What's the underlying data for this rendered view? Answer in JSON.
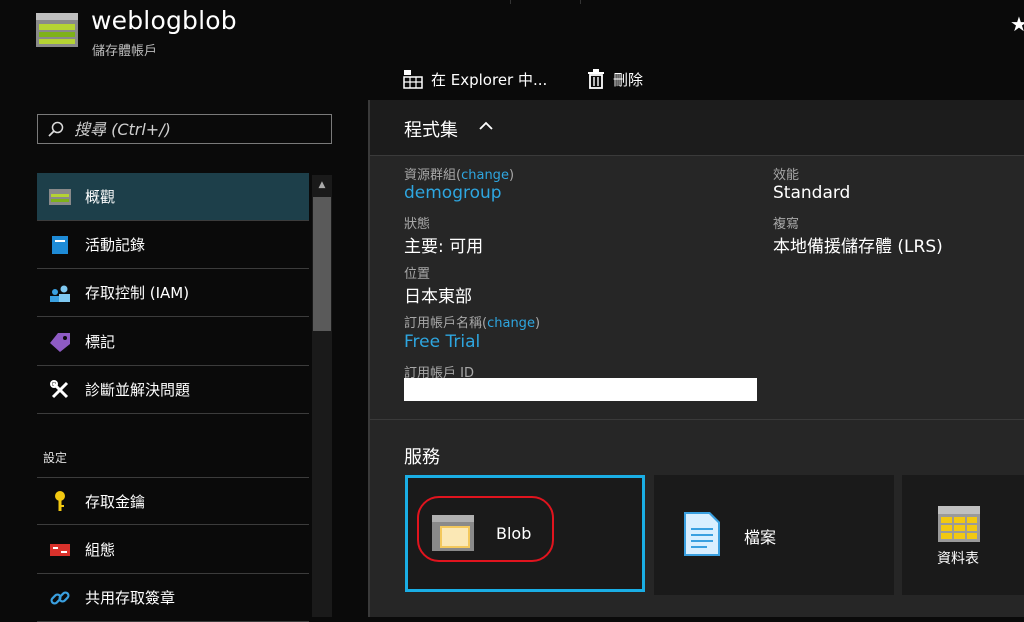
{
  "header": {
    "title": "weblogblob",
    "subtitle": "儲存體帳戶",
    "pin_glyph": "★"
  },
  "toolbar": {
    "explorer_label": "在 Explorer 中...",
    "delete_label": "刪除"
  },
  "search": {
    "placeholder": "搜尋 (Ctrl+/)"
  },
  "nav": {
    "items": [
      {
        "label": "概觀",
        "icon": "overview-icon",
        "active": true
      },
      {
        "label": "活動記錄",
        "icon": "activity-log-icon"
      },
      {
        "label": "存取控制 (IAM)",
        "icon": "iam-icon"
      },
      {
        "label": "標記",
        "icon": "tag-icon"
      },
      {
        "label": "診斷並解決問題",
        "icon": "wrench-icon"
      }
    ],
    "settings_section": "設定",
    "settings_items": [
      {
        "label": "存取金鑰",
        "icon": "key-icon"
      },
      {
        "label": "組態",
        "icon": "configuration-icon"
      },
      {
        "label": "共用存取簽章",
        "icon": "link-icon"
      }
    ]
  },
  "essentials": {
    "title": "程式集",
    "resource_group_label": "資源群組",
    "change_link": "change",
    "resource_group_value": "demogroup",
    "status_label": "狀態",
    "status_value": "主要: 可用",
    "location_label": "位置",
    "location_value": "日本東部",
    "subscription_name_label": "訂用帳戶名稱",
    "subscription_name_value": "Free Trial",
    "subscription_id_label": "訂用帳戶 ID",
    "performance_label": "效能",
    "performance_value": "Standard",
    "replication_label": "複寫",
    "replication_value": "本地備援儲存體 (LRS)"
  },
  "services": {
    "title": "服務",
    "tiles": [
      {
        "label": "Blob",
        "icon": "blob-icon"
      },
      {
        "label": "檔案",
        "icon": "file-icon"
      },
      {
        "label": "資料表",
        "icon": "table-icon"
      }
    ]
  },
  "colors": {
    "accent_blue": "#1aaee5",
    "link_blue": "#2ea6e0",
    "active_nav": "#1d3f4a",
    "highlight_red": "#e0141e"
  }
}
